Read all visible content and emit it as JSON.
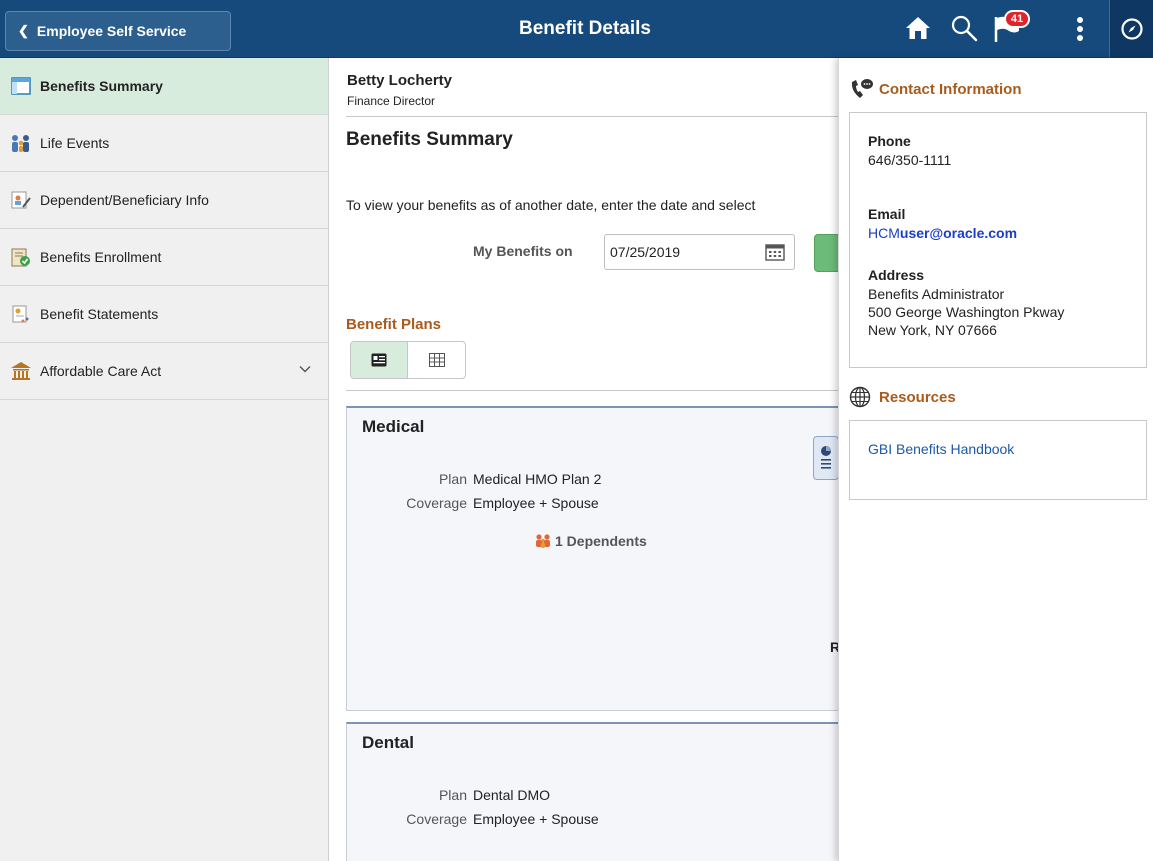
{
  "header": {
    "back_label": "Employee Self Service",
    "title": "Benefit Details",
    "notification_count": "41",
    "icons": [
      "home-icon",
      "search-icon",
      "flag-icon",
      "kebab-menu-icon",
      "navbar-compass-icon"
    ],
    "bg_color": "#174a7c"
  },
  "sidebar": {
    "items": [
      {
        "label": "Benefits Summary",
        "icon": "summary-icon",
        "active": true
      },
      {
        "label": "Life Events",
        "icon": "family-icon"
      },
      {
        "label": "Dependent/Beneficiary Info",
        "icon": "dependent-icon"
      },
      {
        "label": "Benefits Enrollment",
        "icon": "enrollment-icon"
      },
      {
        "label": "Benefit Statements",
        "icon": "statement-icon"
      },
      {
        "label": "Affordable Care Act",
        "icon": "building-icon",
        "expandable": true
      }
    ],
    "active_color": "#d7ecdc"
  },
  "main": {
    "employee_name": "Betty Locherty",
    "employee_title": "Finance Director",
    "section_title": "Benefits Summary",
    "instructions": "To view your benefits as of another date, enter the date and select",
    "date_label": "My Benefits on",
    "date_value": "07/25/2019",
    "plans_title": "Benefit Plans",
    "cards": {
      "medical": {
        "title": "Medical",
        "plan_label": "Plan",
        "plan_value": "Medical HMO Plan 2",
        "coverage_label": "Coverage",
        "coverage_value": "Employee + Spouse",
        "dependents": "1 Dependents",
        "cut_letter": "R"
      },
      "dental": {
        "title": "Dental",
        "plan_label": "Plan",
        "plan_value": "Dental DMO",
        "coverage_label": "Coverage",
        "coverage_value": "Employee + Spouse"
      }
    }
  },
  "right_panel": {
    "contact_title": "Contact Information",
    "phone_label": "Phone",
    "phone_value": "646/350-1111",
    "email_label": "Email",
    "email_prefix": "HCM",
    "email_rest": "user@oracle.com",
    "address_label": "Address",
    "address_line1": "Benefits Administrator",
    "address_line2": "500 George Washington Pkway",
    "address_line3": "New York, NY 07666",
    "resources_title": "Resources",
    "handbook_link": "GBI Benefits Handbook",
    "accent_color": "#a85b1c"
  }
}
